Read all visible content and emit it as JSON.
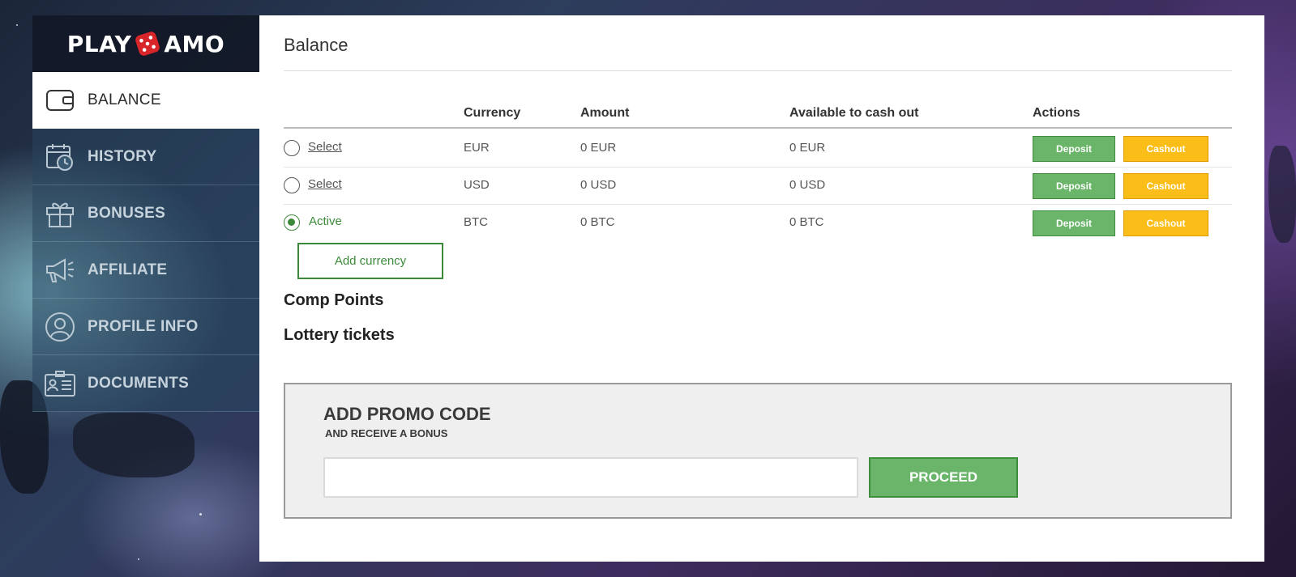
{
  "brand": {
    "logo_left": "PLAY",
    "logo_right": "AMO",
    "dice_color": "#d8252a"
  },
  "sidebar": {
    "items": [
      {
        "label": "BALANCE",
        "icon": "wallet-icon",
        "active": true
      },
      {
        "label": "HISTORY",
        "icon": "calendar-clock-icon",
        "active": false
      },
      {
        "label": "BONUSES",
        "icon": "gift-icon",
        "active": false
      },
      {
        "label": "AFFILIATE",
        "icon": "megaphone-icon",
        "active": false
      },
      {
        "label": "PROFILE INFO",
        "icon": "user-icon",
        "active": false
      },
      {
        "label": "DOCUMENTS",
        "icon": "id-card-icon",
        "active": false
      }
    ]
  },
  "main": {
    "title": "Balance",
    "columns": [
      "Currency",
      "Amount",
      "Available to cash out",
      "Actions"
    ],
    "rows": [
      {
        "status": "Select",
        "currency": "EUR",
        "amount": "0 EUR",
        "available": "0 EUR",
        "deposit": "Deposit",
        "cashout": "Cashout",
        "selected": false
      },
      {
        "status": "Select",
        "currency": "USD",
        "amount": "0 USD",
        "available": "0 USD",
        "deposit": "Deposit",
        "cashout": "Cashout",
        "selected": false
      },
      {
        "status": "Active",
        "currency": "BTC",
        "amount": "0 BTC",
        "available": "0 BTC",
        "deposit": "Deposit",
        "cashout": "Cashout",
        "selected": true
      }
    ],
    "add_currency_label": "Add currency",
    "comp_points_label": "Comp Points",
    "lottery_tickets_label": "Lottery tickets",
    "promo": {
      "title": "ADD PROMO CODE",
      "subtitle": "AND RECEIVE A BONUS",
      "input_value": "",
      "proceed_label": "PROCEED"
    }
  },
  "colors": {
    "green": "#6ab56a",
    "green_dark": "#3a8a3a",
    "yellow": "#fbbd18",
    "panel_bg": "#ffffff",
    "promo_bg": "#efefef"
  }
}
